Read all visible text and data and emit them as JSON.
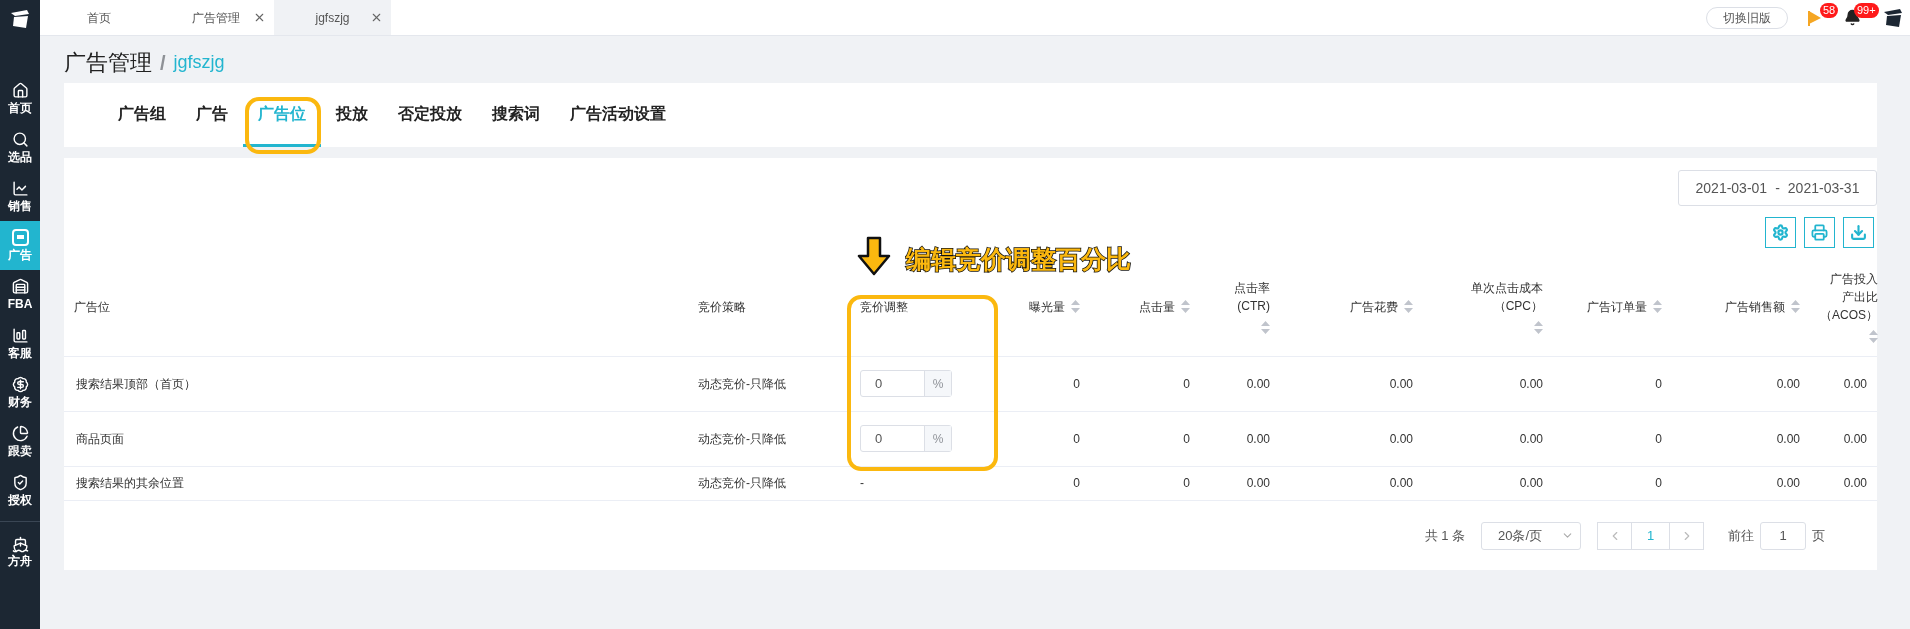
{
  "sidebar": {
    "items": [
      {
        "label": "首页",
        "selected": false
      },
      {
        "label": "选品",
        "selected": false
      },
      {
        "label": "销售",
        "selected": false
      },
      {
        "label": "广告",
        "selected": true
      },
      {
        "label": "FBA",
        "selected": false
      },
      {
        "label": "客服",
        "selected": false
      },
      {
        "label": "财务",
        "selected": false
      },
      {
        "label": "跟卖",
        "selected": false
      },
      {
        "label": "授权",
        "selected": false
      }
    ],
    "bottom_item": {
      "label": "方舟",
      "selected": false
    }
  },
  "top_tabs": [
    {
      "label": "首页",
      "selected": false,
      "closable": false
    },
    {
      "label": "广告管理",
      "selected": false,
      "closable": true
    },
    {
      "label": "jgfszjg",
      "selected": true,
      "closable": true
    }
  ],
  "top_right": {
    "switch_button": "切换旧版",
    "flag_badge": "58",
    "bell_badge": "99+"
  },
  "breadcrumb": {
    "title": "广告管理",
    "separator": "/",
    "current": "jgfszjg"
  },
  "tabs": [
    {
      "label": "广告组",
      "selected": false
    },
    {
      "label": "广告",
      "selected": false
    },
    {
      "label": "广告位",
      "selected": true
    },
    {
      "label": "投放",
      "selected": false
    },
    {
      "label": "否定投放",
      "selected": false
    },
    {
      "label": "搜索词",
      "selected": false
    },
    {
      "label": "广告活动设置",
      "selected": false
    }
  ],
  "date_range": {
    "start": "2021-03-01",
    "separator": "-",
    "end": "2021-03-31"
  },
  "annotation": {
    "text": "编辑竞价调整百分比"
  },
  "table": {
    "columns": [
      {
        "label": "广告位",
        "sortable": false
      },
      {
        "label": "竞价策略",
        "sortable": false
      },
      {
        "label": "竞价调整",
        "sortable": false
      },
      {
        "label": "曝光量",
        "sortable": true
      },
      {
        "label": "点击量",
        "sortable": true
      },
      {
        "label": "点击率(CTR)",
        "sortable": true
      },
      {
        "label": "广告花费",
        "sortable": true
      },
      {
        "label": "单次点击成本（CPC）",
        "sortable": true
      },
      {
        "label": "广告订单量",
        "sortable": true
      },
      {
        "label": "广告销售额",
        "sortable": true
      },
      {
        "label": "广告投入产出比（ACOS）",
        "sortable": true
      }
    ],
    "rows": [
      {
        "placement": "搜索结果顶部（首页）",
        "strategy": "动态竞价-只降低",
        "adjustment": {
          "kind": "input",
          "value": "0",
          "unit": "%"
        },
        "metrics": [
          "0",
          "0",
          "0.00",
          "0.00",
          "0.00",
          "0",
          "0.00",
          "0.00"
        ]
      },
      {
        "placement": "商品页面",
        "strategy": "动态竞价-只降低",
        "adjustment": {
          "kind": "input",
          "value": "0",
          "unit": "%"
        },
        "metrics": [
          "0",
          "0",
          "0.00",
          "0.00",
          "0.00",
          "0",
          "0.00",
          "0.00"
        ]
      },
      {
        "placement": "搜索结果的其余位置",
        "strategy": "动态竞价-只降低",
        "adjustment": {
          "kind": "text",
          "value": "-"
        },
        "metrics": [
          "0",
          "0",
          "0.00",
          "0.00",
          "0.00",
          "0",
          "0.00",
          "0.00"
        ]
      }
    ]
  },
  "pagination": {
    "total": "共 1 条",
    "page_size": "20条/页",
    "pages": [
      {
        "label": "1",
        "selected": true
      }
    ],
    "goto_label": "前往",
    "goto_value": "1",
    "page_unit": "页"
  }
}
